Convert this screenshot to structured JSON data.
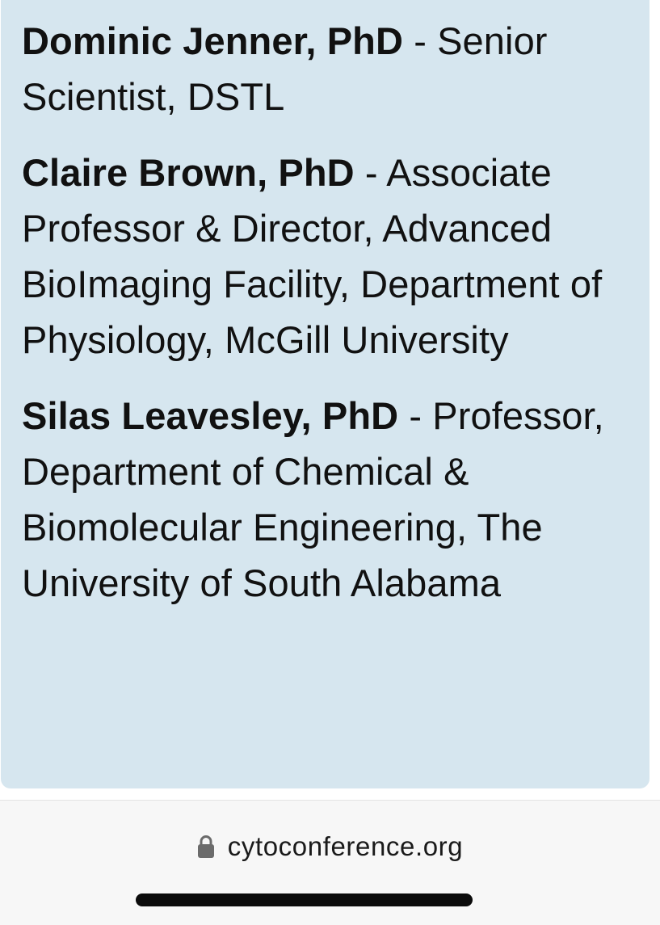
{
  "speakers": [
    {
      "name": "Dominic Jenner, PhD",
      "details": "- Senior Scientist, DSTL"
    },
    {
      "name": "Claire Brown, PhD",
      "details": "- Associate Professor & Director, Advanced BioImaging Facility, Department of Physiology, McGill University"
    },
    {
      "name": "Silas Leavesley, PhD",
      "details": "- Professor, Department of Chemical & Biomolecular Engineering, The University of South Alabama"
    }
  ],
  "browser": {
    "url": "cytoconference.org",
    "lock_icon": "lock-icon"
  },
  "colors": {
    "card_background": "#d6e6ef",
    "text": "#111111"
  }
}
